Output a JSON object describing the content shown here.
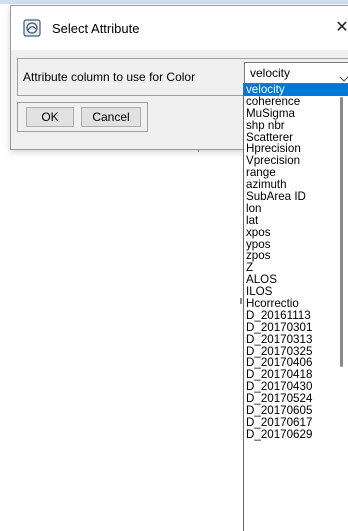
{
  "dialog": {
    "title": "Select Attribute",
    "close_glyph": "✕",
    "label": "Attribute column to use for Color",
    "select_value": "velocity",
    "ok_label": "OK",
    "cancel_label": "Cancel"
  },
  "dropdown": {
    "selected_index": 0,
    "items": [
      "velocity",
      "coherence",
      "MuSigma",
      "shp nbr",
      "Scatterer",
      "Hprecision",
      "Vprecision",
      "range",
      "azimuth",
      "SubArea ID",
      "lon",
      "lat",
      "xpos",
      "ypos",
      "zpos",
      "Z",
      "ALOS",
      "ILOS",
      "Hcorrectio",
      "D_20161113",
      "D_20170301",
      "D_20170313",
      "D_20170325",
      "D_20170406",
      "D_20170418",
      "D_20170430",
      "D_20170524",
      "D_20170605",
      "D_20170617",
      "D_20170629"
    ]
  },
  "colors": {
    "selection": "#0078d7",
    "dialog_bg": "#f0f0f0"
  },
  "icons": {
    "app": "window-app-icon",
    "close": "close-icon",
    "arrow": "chevron-down-icon"
  }
}
